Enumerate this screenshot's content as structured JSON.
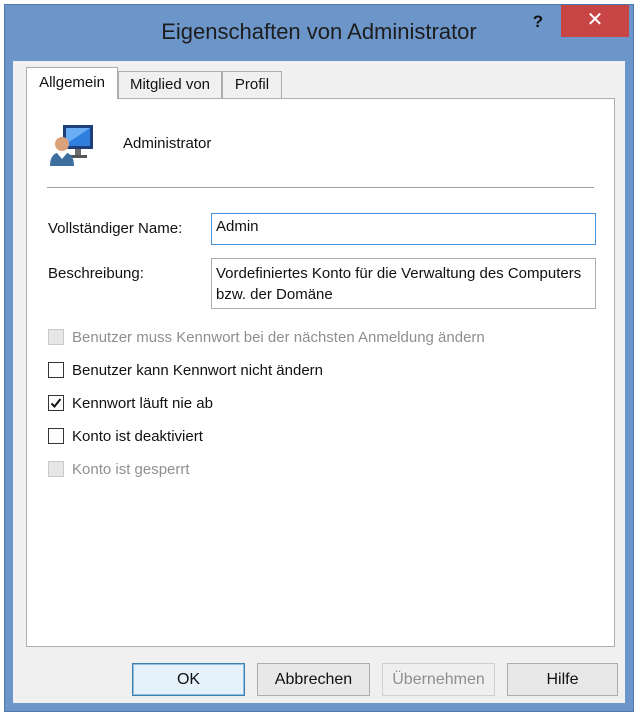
{
  "window": {
    "title": "Eigenschaften von Administrator",
    "help_label": "?",
    "close_label": "✕"
  },
  "tabs": [
    {
      "label": "Allgemein",
      "active": true
    },
    {
      "label": "Mitglied von",
      "active": false
    },
    {
      "label": "Profil",
      "active": false
    }
  ],
  "general": {
    "user_name": "Administrator",
    "full_name_label": "Vollständiger Name:",
    "full_name_value": "Admin",
    "description_label": "Beschreibung:",
    "description_value": "Vordefiniertes Konto für die Verwaltung des Computers bzw. der Domäne"
  },
  "checkboxes": [
    {
      "label": "Benutzer muss Kennwort bei der nächsten Anmeldung ändern",
      "checked": false,
      "enabled": false
    },
    {
      "label": "Benutzer kann Kennwort nicht ändern",
      "checked": false,
      "enabled": true
    },
    {
      "label": "Kennwort läuft nie ab",
      "checked": true,
      "enabled": true
    },
    {
      "label": "Konto ist deaktiviert",
      "checked": false,
      "enabled": true
    },
    {
      "label": "Konto ist gesperrt",
      "checked": false,
      "enabled": false
    }
  ],
  "buttons": {
    "ok": "OK",
    "cancel": "Abbrechen",
    "apply": "Übernehmen",
    "help": "Hilfe"
  },
  "colors": {
    "frame": "#6c95c9",
    "close": "#c74545",
    "accent": "#3c7fb1"
  }
}
